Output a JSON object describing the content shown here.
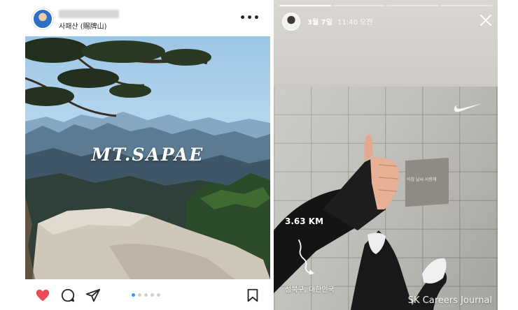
{
  "post": {
    "location": "사패산 (賜牌山)",
    "photo_title": "MT.SAPAE",
    "carousel": {
      "count": 5,
      "active": 1
    },
    "icons": {
      "more": "more-horizontal-icon",
      "like": "heart-icon",
      "comment": "comment-icon",
      "share": "send-icon",
      "save": "bookmark-icon"
    },
    "colors": {
      "like": "#ed4956",
      "carousel_active": "#3897f0"
    }
  },
  "story": {
    "date": "3월 7일",
    "time": "11:40 오전",
    "progress": {
      "segments": 4,
      "viewed": 1
    },
    "distance": "3.63 KM",
    "place": "성북구, 대한민국",
    "plaque_text": "아침 날씨 사랑해",
    "watermark": "SK Careers Journal",
    "icons": {
      "close": "close-icon",
      "route": "route-icon",
      "brand": "nike-swoosh-icon"
    }
  }
}
